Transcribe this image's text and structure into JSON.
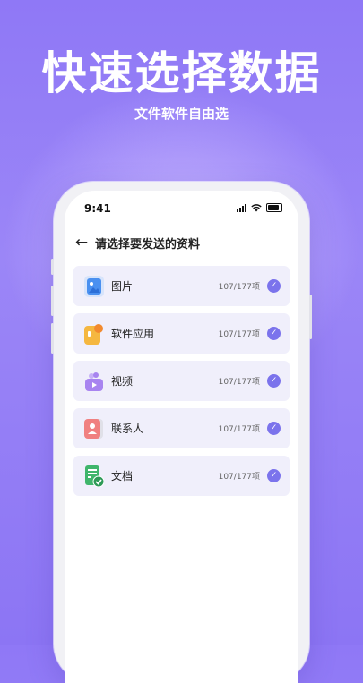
{
  "hero": {
    "title": "快速选择数据",
    "subtitle": "文件软件自由选"
  },
  "status_bar": {
    "time": "9:41"
  },
  "nav": {
    "back_icon": "arrow-left-icon",
    "title": "请选择要发送的资料"
  },
  "categories": [
    {
      "label": "图片",
      "count": "107/177项",
      "icon": "image-icon",
      "color": "#4a90f0"
    },
    {
      "label": "软件应用",
      "count": "107/177项",
      "icon": "app-icon",
      "color": "#f5b740"
    },
    {
      "label": "视频",
      "count": "107/177项",
      "icon": "video-icon",
      "color": "#a884f0"
    },
    {
      "label": "联系人",
      "count": "107/177项",
      "icon": "contact-icon",
      "color": "#f08080"
    },
    {
      "label": "文档",
      "count": "107/177项",
      "icon": "document-icon",
      "color": "#3fb56b"
    }
  ],
  "accent_color": "#7b73ec"
}
